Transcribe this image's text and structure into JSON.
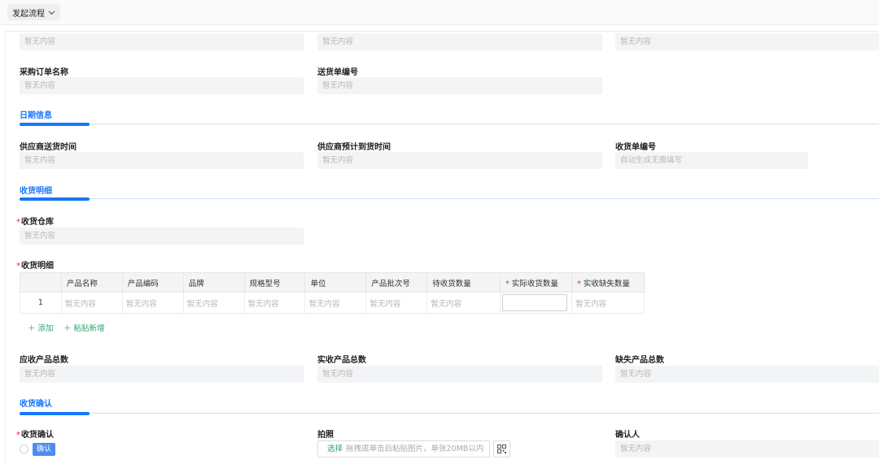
{
  "header": {
    "flow_button": "发起流程"
  },
  "placeholder": "暂无内容",
  "auto_placeholder": "自动生成无需填写",
  "row0": {
    "f1": "暂无内容",
    "f2": "暂无内容",
    "f3": "暂无内容"
  },
  "order": {
    "purchase_name_label": "采购订单名称",
    "purchase_name_value": "暂无内容",
    "delivery_no_label": "送货单编号",
    "delivery_no_value": "暂无内容"
  },
  "sections": {
    "date": "日期信息",
    "detail": "收货明细",
    "confirm": "收货确认"
  },
  "dates": {
    "supplier_delivery_label": "供应商送货时间",
    "supplier_delivery_value": "暂无内容",
    "supplier_expected_label": "供应商预计到货时间",
    "supplier_expected_value": "暂无内容",
    "receipt_no_label": "收货单编号",
    "receipt_no_value": "自动生成无需填写"
  },
  "warehouse": {
    "label": "收货仓库",
    "value": "暂无内容"
  },
  "detail_table": {
    "label": "收货明细",
    "columns": [
      "产品名称",
      "产品编码",
      "品牌",
      "规格型号",
      "单位",
      "产品批次号",
      "待收货数量",
      "实际收货数量",
      "实收缺失数量"
    ],
    "rows": [
      {
        "index": "1",
        "cells": [
          "暂无内容",
          "暂无内容",
          "暂无内容",
          "暂无内容",
          "暂无内容",
          "暂无内容",
          "暂无内容",
          "",
          "暂无内容"
        ]
      }
    ],
    "add_label": "添加",
    "paste_label": "粘贴新增"
  },
  "totals": {
    "expected_label": "应收产品总数",
    "expected_value": "暂无内容",
    "actual_label": "实收产品总数",
    "actual_value": "暂无内容",
    "missing_label": "缺失产品总数",
    "missing_value": "暂无内容"
  },
  "confirm": {
    "label": "收货确认",
    "tag": "确认",
    "photo_label": "拍照",
    "photo_select": "选择",
    "photo_hint": "拖拽或单击后粘贴图片，单张20MB以内",
    "confirmer_label": "确认人",
    "confirmer_value": "暂无内容"
  },
  "colors": {
    "accent": "#1677ff",
    "add_green": "#2aa56b",
    "required": "#f5222d"
  }
}
